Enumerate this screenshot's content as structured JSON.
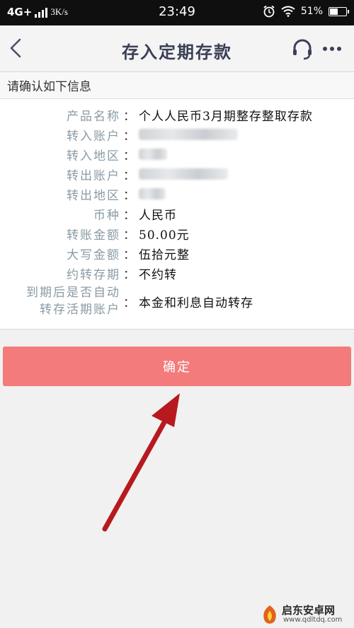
{
  "status_bar": {
    "network": "4G+",
    "speed": "3K/s",
    "time": "23:49",
    "battery": "51%",
    "battery_level": 0.51,
    "icons": [
      "signal-icon",
      "alarm-icon",
      "wifi-icon",
      "battery-icon"
    ]
  },
  "header": {
    "title": "存入定期存款",
    "icons": [
      "back-icon",
      "customer-service-icon",
      "more-icon"
    ]
  },
  "confirm_label": "请确认如下信息",
  "details": [
    {
      "key": "产品名称",
      "value": "个人人民币3月期整存整取存款"
    },
    {
      "key": "转入账户",
      "value": ""
    },
    {
      "key": "转入地区",
      "value": ""
    },
    {
      "key": "转出账户",
      "value": ""
    },
    {
      "key": "转出地区",
      "value": ""
    },
    {
      "key": "币种",
      "value": "人民币"
    },
    {
      "key": "转账金额",
      "value": "50.00元"
    },
    {
      "key": "大写金额",
      "value": "伍拾元整"
    },
    {
      "key": "约转存期",
      "value": "不约转"
    },
    {
      "key_line1": "到期后是否自动",
      "key_line2": "转存活期账户",
      "value": "本金和利息自动转存"
    }
  ],
  "colon": "：",
  "button": {
    "label": "确定",
    "color": "#f37b7b"
  },
  "watermark": {
    "name": "启东安卓网",
    "url": "www.qdltdq.com"
  }
}
